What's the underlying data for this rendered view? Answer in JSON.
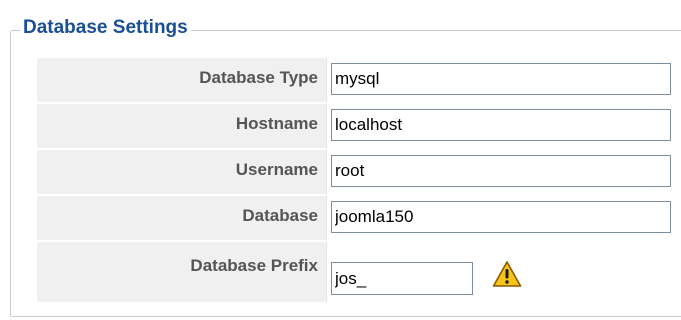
{
  "section": {
    "title": "Database Settings"
  },
  "fields": [
    {
      "label": "Database Type",
      "value": "mysql"
    },
    {
      "label": "Hostname",
      "value": "localhost"
    },
    {
      "label": "Username",
      "value": "root"
    },
    {
      "label": "Database",
      "value": "joomla150"
    },
    {
      "label": "Database Prefix",
      "value": "jos_"
    }
  ],
  "icons": {
    "prefix_warning": "warning-icon"
  },
  "colors": {
    "legend_text": "#1a4f96",
    "label_text": "#555555",
    "label_background": "#f0f0f0",
    "warning_fill": "#f5c518",
    "warning_stroke": "#8a5a00"
  }
}
